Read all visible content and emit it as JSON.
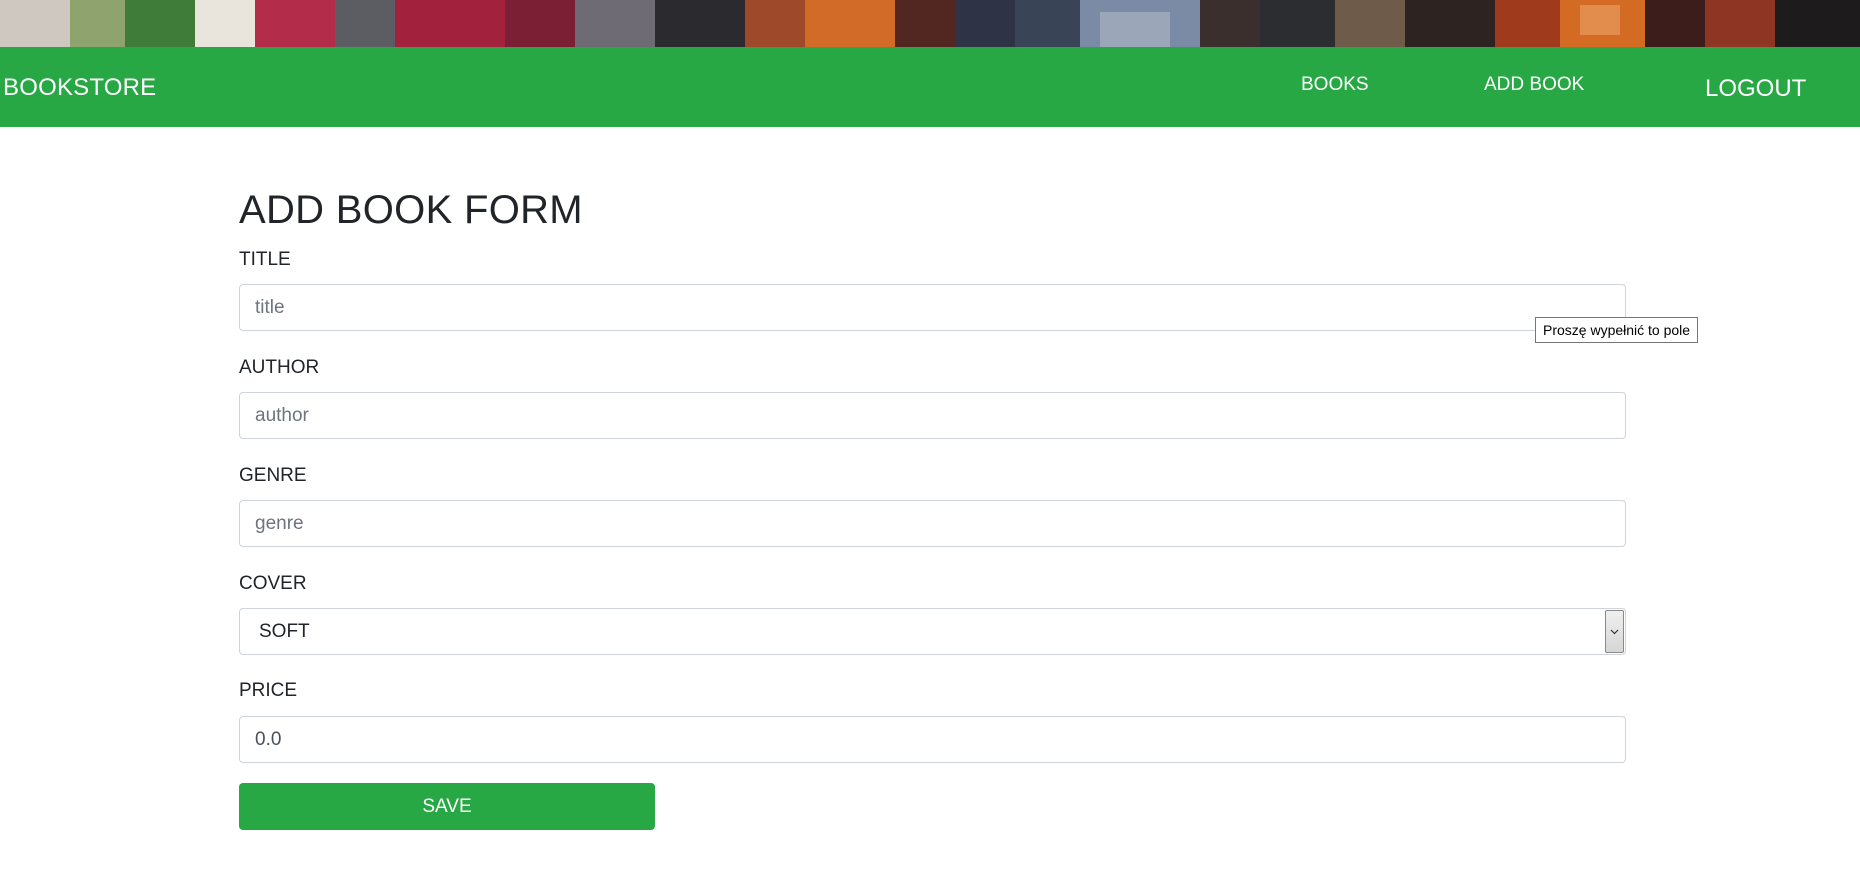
{
  "navbar": {
    "brand": "BOOKSTORE",
    "links": [
      {
        "label": "BOOKS"
      },
      {
        "label": "ADD BOOK"
      },
      {
        "label": "LOGOUT"
      }
    ]
  },
  "form": {
    "title": "ADD BOOK FORM",
    "fields": {
      "title": {
        "label": "TITLE",
        "placeholder": "title",
        "value": ""
      },
      "author": {
        "label": "AUTHOR",
        "placeholder": "author",
        "value": ""
      },
      "genre": {
        "label": "GENRE",
        "placeholder": "genre",
        "value": ""
      },
      "cover": {
        "label": "COVER",
        "selected": "SOFT"
      },
      "price": {
        "label": "PRICE",
        "value": "0.0"
      }
    },
    "save_label": "SAVE"
  },
  "validation_tooltip": "Proszę wypełnić to pole",
  "colors": {
    "primary_green": "#28a745",
    "border": "#ced4da",
    "text": "#212529"
  }
}
